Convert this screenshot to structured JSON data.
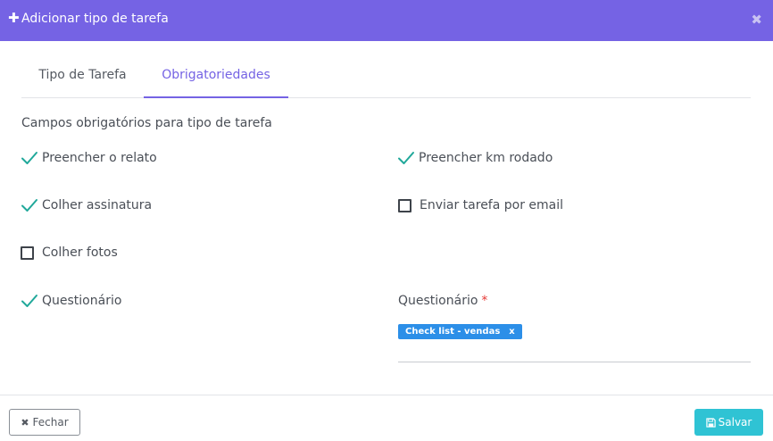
{
  "colors": {
    "header": "#7563e4",
    "accent": "#7563e4",
    "check": "#20a89a",
    "tag": "#2c8fe8",
    "save": "#2fc3d4",
    "required": "#e53935"
  },
  "modal": {
    "plus_icon": "plus-icon",
    "title": "Adicionar tipo de tarefa",
    "close_icon": "close-icon"
  },
  "tabs": [
    {
      "label": "Tipo de Tarefa",
      "active": false
    },
    {
      "label": "Obrigatoriedades",
      "active": true
    }
  ],
  "section_label": "Campos obrigatórios para tipo de tarefa",
  "options": {
    "preencher_relato": {
      "label": "Preencher o relato",
      "checked": true
    },
    "preencher_km": {
      "label": "Preencher km rodado",
      "checked": true
    },
    "colher_assinatura": {
      "label": "Colher assinatura",
      "checked": true
    },
    "enviar_email": {
      "label": "Enviar tarefa por email",
      "checked": false
    },
    "colher_fotos": {
      "label": "Colher fotos",
      "checked": false
    },
    "questionario": {
      "label": "Questionário",
      "checked": true
    }
  },
  "questionario_field": {
    "label": "Questionário",
    "required_mark": "*",
    "selected_tag": "Check list - vendas",
    "tag_remove": "x"
  },
  "footer": {
    "close_label": "Fechar",
    "close_icon": "times-icon",
    "save_label": "Salvar",
    "save_icon": "floppy-icon"
  }
}
